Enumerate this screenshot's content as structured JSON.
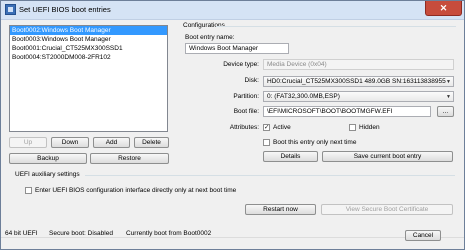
{
  "window": {
    "title": "Set UEFI BIOS boot entries",
    "close_glyph": "✕"
  },
  "list": {
    "items": [
      "Boot0002:Windows Boot Manager",
      "Boot0003:Windows Boot Manager",
      "Boot0001:Crucial_CT525MX300SSD1",
      "Boot0004:ST2000DM008-2FR102"
    ],
    "selected_index": 0
  },
  "list_buttons": {
    "up": "Up",
    "down": "Down",
    "add": "Add",
    "delete": "Delete",
    "backup": "Backup",
    "restore": "Restore"
  },
  "config": {
    "heading": "Configurations",
    "entry_name_label": "Boot entry name:",
    "entry_name_value": "Windows Boot Manager",
    "device_type_label": "Device type:",
    "device_type_value": "Media Device (0x04)",
    "disk_label": "Disk:",
    "disk_value": "HD0:Crucial_CT525MX300SSD1 489.0GB SN:163113838955",
    "partition_label": "Partition:",
    "partition_value": "0: (FAT32,300.0MB,ESP)",
    "boot_file_label": "Boot file:",
    "boot_file_value": "\\EFI\\MICROSOFT\\BOOT\\BOOTMGFW.EFI",
    "browse_label": "...",
    "attributes_label": "Attributes:",
    "active_label": "Active",
    "active_checked": true,
    "hidden_label": "Hidden",
    "hidden_checked": false,
    "boot_once_label": "Boot this entry only next time",
    "boot_once_checked": false,
    "details_label": "Details",
    "save_label": "Save current boot entry",
    "check_glyph": "✓"
  },
  "aux": {
    "heading": "UEFI auxiliary settings",
    "enter_bios_label": "Enter UEFI BIOS configuration interface directly only at next boot time",
    "enter_bios_checked": false,
    "restart_label": "Restart now",
    "secure_cert_label": "View Secure Boot Certificate"
  },
  "status": {
    "bits": "64 bit UEFI",
    "secure_boot": "Secure boot: Disabled",
    "current_boot": "Currently boot from Boot0002",
    "cancel_label": "Cancel"
  },
  "colors": {
    "selection": "#3399ff",
    "title_bar": "#d5e3f5",
    "close_button": "#c74c3c"
  }
}
